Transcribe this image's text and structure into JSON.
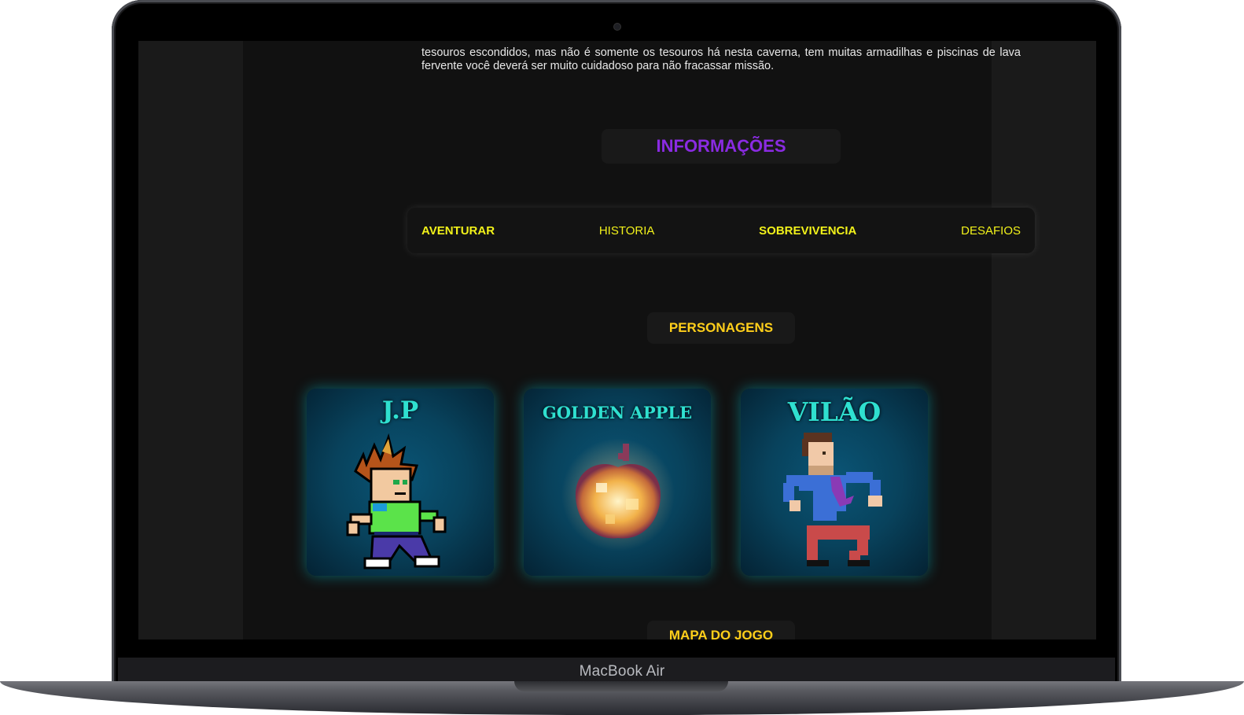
{
  "device": {
    "label": "MacBook Air"
  },
  "intro": {
    "text": "tesouros escondidos, mas não é somente os tesouros há nesta caverna, tem muitas armadilhas e piscinas de lava fervente você deverá ser muito cuidadoso para não fracassar missão."
  },
  "info_section": {
    "title": "INFORMAÇÕES"
  },
  "nav": {
    "items": [
      {
        "label": "AVENTURAR"
      },
      {
        "label": "HISTORIA"
      },
      {
        "label": "SOBREVIVENCIA"
      },
      {
        "label": "DESAFIOS"
      }
    ]
  },
  "characters_section": {
    "title": "PERSONAGENS",
    "cards": [
      {
        "name": "J.P",
        "icon": "hero-sprite"
      },
      {
        "name": "GOLDEN APPLE",
        "icon": "golden-apple-sprite"
      },
      {
        "name": "VILÃO",
        "icon": "villain-sprite"
      }
    ]
  },
  "map_section": {
    "title": "MAPA DO JOGO"
  },
  "colors": {
    "page_bg": "#111111",
    "accent_purple": "#8a2be2",
    "nav_yellow": "#f2f21a",
    "title_gold": "#ffcf1a",
    "card_teal": "#2fe0d0"
  }
}
